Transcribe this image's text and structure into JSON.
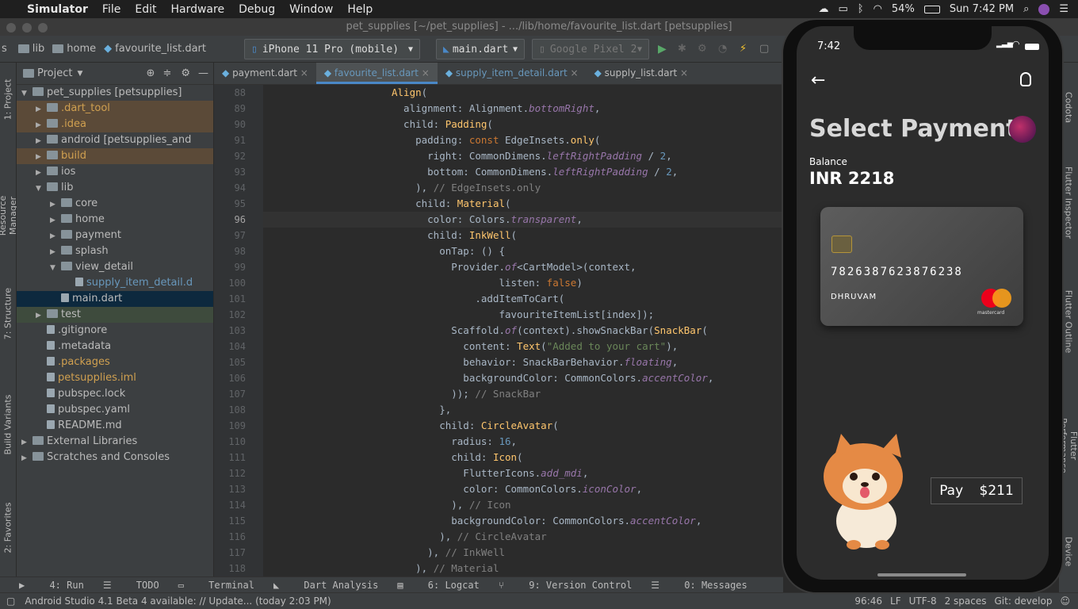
{
  "menubar": {
    "app": "Simulator",
    "items": [
      "File",
      "Edit",
      "Hardware",
      "Debug",
      "Window",
      "Help"
    ],
    "battery": "54%",
    "clock": "Sun 7:42 PM"
  },
  "window": {
    "title": "pet_supplies [~/pet_supplies] - .../lib/home/favourite_list.dart [petsupplies]"
  },
  "navbar": {
    "crumbs": [
      "s",
      "lib",
      "home",
      "favourite_list.dart"
    ],
    "device": "iPhone 11 Pro (mobile)",
    "config": "main.dart",
    "emulator": "Google Pixel 2"
  },
  "left_tool_tabs": [
    "1: Project",
    "Resource Manager",
    "7: Structure",
    "Build Variants",
    "2: Favorites"
  ],
  "project": {
    "header": "Project",
    "tree": [
      {
        "label": "pet_supplies [petsupplies]",
        "indent": 0,
        "expanded": true
      },
      {
        "label": ".dart_tool",
        "indent": 1,
        "hl": "excluded"
      },
      {
        "label": ".idea",
        "indent": 1,
        "hl": "excluded"
      },
      {
        "label": "android [petsupplies_and",
        "indent": 1
      },
      {
        "label": "build",
        "indent": 1,
        "hl": "excluded"
      },
      {
        "label": "ios",
        "indent": 1
      },
      {
        "label": "lib",
        "indent": 1,
        "expanded": true
      },
      {
        "label": "core",
        "indent": 2
      },
      {
        "label": "home",
        "indent": 2
      },
      {
        "label": "payment",
        "indent": 2
      },
      {
        "label": "splash",
        "indent": 2
      },
      {
        "label": "view_detail",
        "indent": 2,
        "expanded": true
      },
      {
        "label": "supply_item_detail.d",
        "indent": 3,
        "link": true
      },
      {
        "label": "main.dart",
        "indent": 2,
        "selected": true
      },
      {
        "label": "test",
        "indent": 1,
        "hl": "test"
      },
      {
        "label": ".gitignore",
        "indent": 1
      },
      {
        "label": ".metadata",
        "indent": 1
      },
      {
        "label": ".packages",
        "indent": 1,
        "hl": "yellow"
      },
      {
        "label": "petsupplies.iml",
        "indent": 1,
        "hl": "yellow"
      },
      {
        "label": "pubspec.lock",
        "indent": 1
      },
      {
        "label": "pubspec.yaml",
        "indent": 1
      },
      {
        "label": "README.md",
        "indent": 1
      },
      {
        "label": "External Libraries",
        "indent": 0
      },
      {
        "label": "Scratches and Consoles",
        "indent": 0
      }
    ]
  },
  "tabs": [
    "payment.dart",
    "favourite_list.dart",
    "supply_item_detail.dart",
    "supply_list.dart"
  ],
  "active_tab": 1,
  "gutter": [
    "88",
    "89",
    "90",
    "91",
    "92",
    "93",
    "94",
    "95",
    "96",
    "97",
    "98",
    "99",
    "100",
    "101",
    "102",
    "103",
    "104",
    "105",
    "106",
    "107",
    "108",
    "109",
    "110",
    "111",
    "112",
    "113",
    "114",
    "115",
    "116",
    "117",
    "118"
  ],
  "code": [
    "<span class=\"f\">Align</span>(",
    "  alignment: Alignment.<span class=\"i\">bottomRight</span>,",
    "  child: <span class=\"f\">Padding</span>(",
    "    padding: <span class=\"k\">const</span> EdgeInsets.<span class=\"f\">only</span>(",
    "      right: CommonDimens.<span class=\"i\">leftRightPadding</span> / <span class=\"n\">2</span>,",
    "      bottom: CommonDimens.<span class=\"i\">leftRightPadding</span> / <span class=\"n\">2</span>,",
    "    ), <span class=\"c\">// EdgeInsets.only</span>",
    "    child: <span class=\"f\">Material</span>(",
    "      color: Colors.<span class=\"i\">transparent</span>,",
    "      child: <span class=\"f\">InkWell</span>(",
    "        onTap: () {",
    "          Provider.<span class=\"i\">of</span>&lt;CartModel&gt;(context,",
    "                  listen: <span class=\"k\">false</span>)",
    "              .addItemToCart(",
    "                  favouriteItemList[index]);",
    "          Scaffold.<span class=\"i\">of</span>(context).showSnackBar(<span class=\"f\">SnackBar</span>(",
    "            content: <span class=\"f\">Text</span>(<span class=\"s\">\"Added to your cart\"</span>),",
    "            behavior: SnackBarBehavior.<span class=\"i\">floating</span>,",
    "            backgroundColor: CommonColors.<span class=\"i\">accentColor</span>,",
    "          )); <span class=\"c\">// SnackBar</span>",
    "        },",
    "        child: <span class=\"f\">CircleAvatar</span>(",
    "          radius: <span class=\"n\">16</span>,",
    "          child: <span class=\"f\">Icon</span>(",
    "            FlutterIcons.<span class=\"i\">add_mdi</span>,",
    "            color: CommonColors.<span class=\"i\">iconColor</span>,",
    "          ), <span class=\"c\">// Icon</span>",
    "          backgroundColor: CommonColors.<span class=\"i\">accentColor</span>,",
    "        ), <span class=\"c\">// CircleAvatar</span>",
    "      ), <span class=\"c\">// InkWell</span>",
    "    ), <span class=\"c\">// Material</span>"
  ],
  "bottom_tabs": [
    "4: Run",
    "TODO",
    "Terminal",
    "Dart Analysis",
    "6: Logcat",
    "9: Version Control",
    "0: Messages"
  ],
  "status": {
    "message": "Android Studio 4.1 Beta 4 available: // Update... (today 2:03 PM)",
    "position": "96:46",
    "eol": "LF",
    "encoding": "UTF-8",
    "indent": "2 spaces",
    "git": "Git: develop"
  },
  "right_tool_tabs": [
    "Codota",
    "Flutter Inspector",
    "Flutter Outline",
    "Flutter Performance",
    "Device"
  ],
  "phone": {
    "time": "7:42",
    "title": "Select Payment",
    "balance_label": "Balance",
    "balance": "INR 2218",
    "card_number": "7826387623876238",
    "card_holder": "DHRUVAM",
    "card_brand": "mastercard",
    "pay_label": "Pay",
    "pay_amount": "$211"
  }
}
